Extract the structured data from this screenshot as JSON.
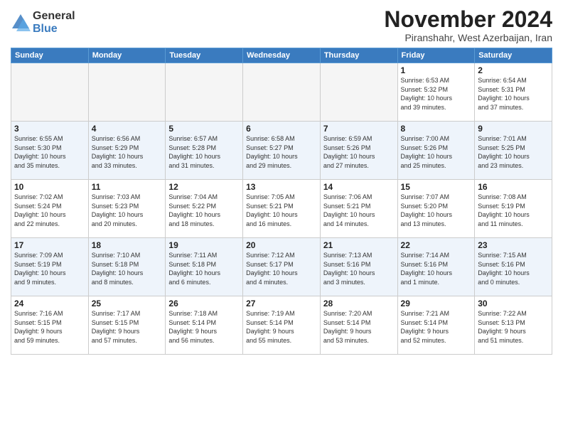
{
  "logo": {
    "general": "General",
    "blue": "Blue"
  },
  "header": {
    "month": "November 2024",
    "location": "Piranshahr, West Azerbaijan, Iran"
  },
  "weekdays": [
    "Sunday",
    "Monday",
    "Tuesday",
    "Wednesday",
    "Thursday",
    "Friday",
    "Saturday"
  ],
  "weeks": [
    [
      {
        "day": "",
        "info": ""
      },
      {
        "day": "",
        "info": ""
      },
      {
        "day": "",
        "info": ""
      },
      {
        "day": "",
        "info": ""
      },
      {
        "day": "",
        "info": ""
      },
      {
        "day": "1",
        "info": "Sunrise: 6:53 AM\nSunset: 5:32 PM\nDaylight: 10 hours\nand 39 minutes."
      },
      {
        "day": "2",
        "info": "Sunrise: 6:54 AM\nSunset: 5:31 PM\nDaylight: 10 hours\nand 37 minutes."
      }
    ],
    [
      {
        "day": "3",
        "info": "Sunrise: 6:55 AM\nSunset: 5:30 PM\nDaylight: 10 hours\nand 35 minutes."
      },
      {
        "day": "4",
        "info": "Sunrise: 6:56 AM\nSunset: 5:29 PM\nDaylight: 10 hours\nand 33 minutes."
      },
      {
        "day": "5",
        "info": "Sunrise: 6:57 AM\nSunset: 5:28 PM\nDaylight: 10 hours\nand 31 minutes."
      },
      {
        "day": "6",
        "info": "Sunrise: 6:58 AM\nSunset: 5:27 PM\nDaylight: 10 hours\nand 29 minutes."
      },
      {
        "day": "7",
        "info": "Sunrise: 6:59 AM\nSunset: 5:26 PM\nDaylight: 10 hours\nand 27 minutes."
      },
      {
        "day": "8",
        "info": "Sunrise: 7:00 AM\nSunset: 5:26 PM\nDaylight: 10 hours\nand 25 minutes."
      },
      {
        "day": "9",
        "info": "Sunrise: 7:01 AM\nSunset: 5:25 PM\nDaylight: 10 hours\nand 23 minutes."
      }
    ],
    [
      {
        "day": "10",
        "info": "Sunrise: 7:02 AM\nSunset: 5:24 PM\nDaylight: 10 hours\nand 22 minutes."
      },
      {
        "day": "11",
        "info": "Sunrise: 7:03 AM\nSunset: 5:23 PM\nDaylight: 10 hours\nand 20 minutes."
      },
      {
        "day": "12",
        "info": "Sunrise: 7:04 AM\nSunset: 5:22 PM\nDaylight: 10 hours\nand 18 minutes."
      },
      {
        "day": "13",
        "info": "Sunrise: 7:05 AM\nSunset: 5:21 PM\nDaylight: 10 hours\nand 16 minutes."
      },
      {
        "day": "14",
        "info": "Sunrise: 7:06 AM\nSunset: 5:21 PM\nDaylight: 10 hours\nand 14 minutes."
      },
      {
        "day": "15",
        "info": "Sunrise: 7:07 AM\nSunset: 5:20 PM\nDaylight: 10 hours\nand 13 minutes."
      },
      {
        "day": "16",
        "info": "Sunrise: 7:08 AM\nSunset: 5:19 PM\nDaylight: 10 hours\nand 11 minutes."
      }
    ],
    [
      {
        "day": "17",
        "info": "Sunrise: 7:09 AM\nSunset: 5:19 PM\nDaylight: 10 hours\nand 9 minutes."
      },
      {
        "day": "18",
        "info": "Sunrise: 7:10 AM\nSunset: 5:18 PM\nDaylight: 10 hours\nand 8 minutes."
      },
      {
        "day": "19",
        "info": "Sunrise: 7:11 AM\nSunset: 5:18 PM\nDaylight: 10 hours\nand 6 minutes."
      },
      {
        "day": "20",
        "info": "Sunrise: 7:12 AM\nSunset: 5:17 PM\nDaylight: 10 hours\nand 4 minutes."
      },
      {
        "day": "21",
        "info": "Sunrise: 7:13 AM\nSunset: 5:16 PM\nDaylight: 10 hours\nand 3 minutes."
      },
      {
        "day": "22",
        "info": "Sunrise: 7:14 AM\nSunset: 5:16 PM\nDaylight: 10 hours\nand 1 minute."
      },
      {
        "day": "23",
        "info": "Sunrise: 7:15 AM\nSunset: 5:16 PM\nDaylight: 10 hours\nand 0 minutes."
      }
    ],
    [
      {
        "day": "24",
        "info": "Sunrise: 7:16 AM\nSunset: 5:15 PM\nDaylight: 9 hours\nand 59 minutes."
      },
      {
        "day": "25",
        "info": "Sunrise: 7:17 AM\nSunset: 5:15 PM\nDaylight: 9 hours\nand 57 minutes."
      },
      {
        "day": "26",
        "info": "Sunrise: 7:18 AM\nSunset: 5:14 PM\nDaylight: 9 hours\nand 56 minutes."
      },
      {
        "day": "27",
        "info": "Sunrise: 7:19 AM\nSunset: 5:14 PM\nDaylight: 9 hours\nand 55 minutes."
      },
      {
        "day": "28",
        "info": "Sunrise: 7:20 AM\nSunset: 5:14 PM\nDaylight: 9 hours\nand 53 minutes."
      },
      {
        "day": "29",
        "info": "Sunrise: 7:21 AM\nSunset: 5:14 PM\nDaylight: 9 hours\nand 52 minutes."
      },
      {
        "day": "30",
        "info": "Sunrise: 7:22 AM\nSunset: 5:13 PM\nDaylight: 9 hours\nand 51 minutes."
      }
    ]
  ]
}
